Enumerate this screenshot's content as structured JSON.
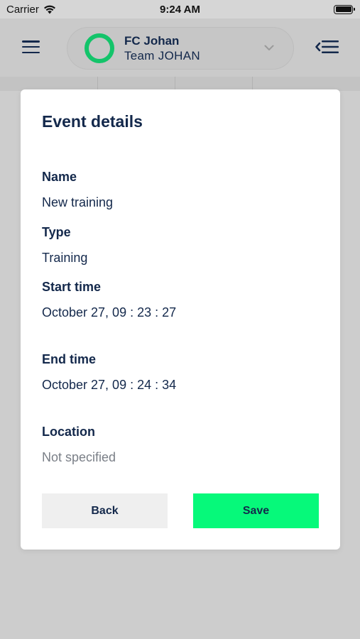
{
  "status_bar": {
    "carrier": "Carrier",
    "time": "9:24 AM"
  },
  "header": {
    "team_name": "FC Johan",
    "team_subtitle": "Team JOHAN",
    "menu_icon": "hamburger-menu-icon",
    "collapse_icon": "collapse-menu-icon"
  },
  "modal": {
    "title": "Event details",
    "fields": [
      {
        "label": "Name",
        "value": "New training"
      },
      {
        "label": "Type",
        "value": "Training"
      },
      {
        "label": "Start time",
        "value": "October 27, 09 : 23 : 27"
      },
      {
        "label": "End time",
        "value": "October 27, 09 : 24 : 34"
      },
      {
        "label": "Location",
        "value": "Not specified"
      }
    ],
    "back_label": "Back",
    "save_label": "Save"
  },
  "colors": {
    "accent_green": "#06f97a",
    "ring_green": "#13c46a",
    "navy": "#13284b"
  }
}
